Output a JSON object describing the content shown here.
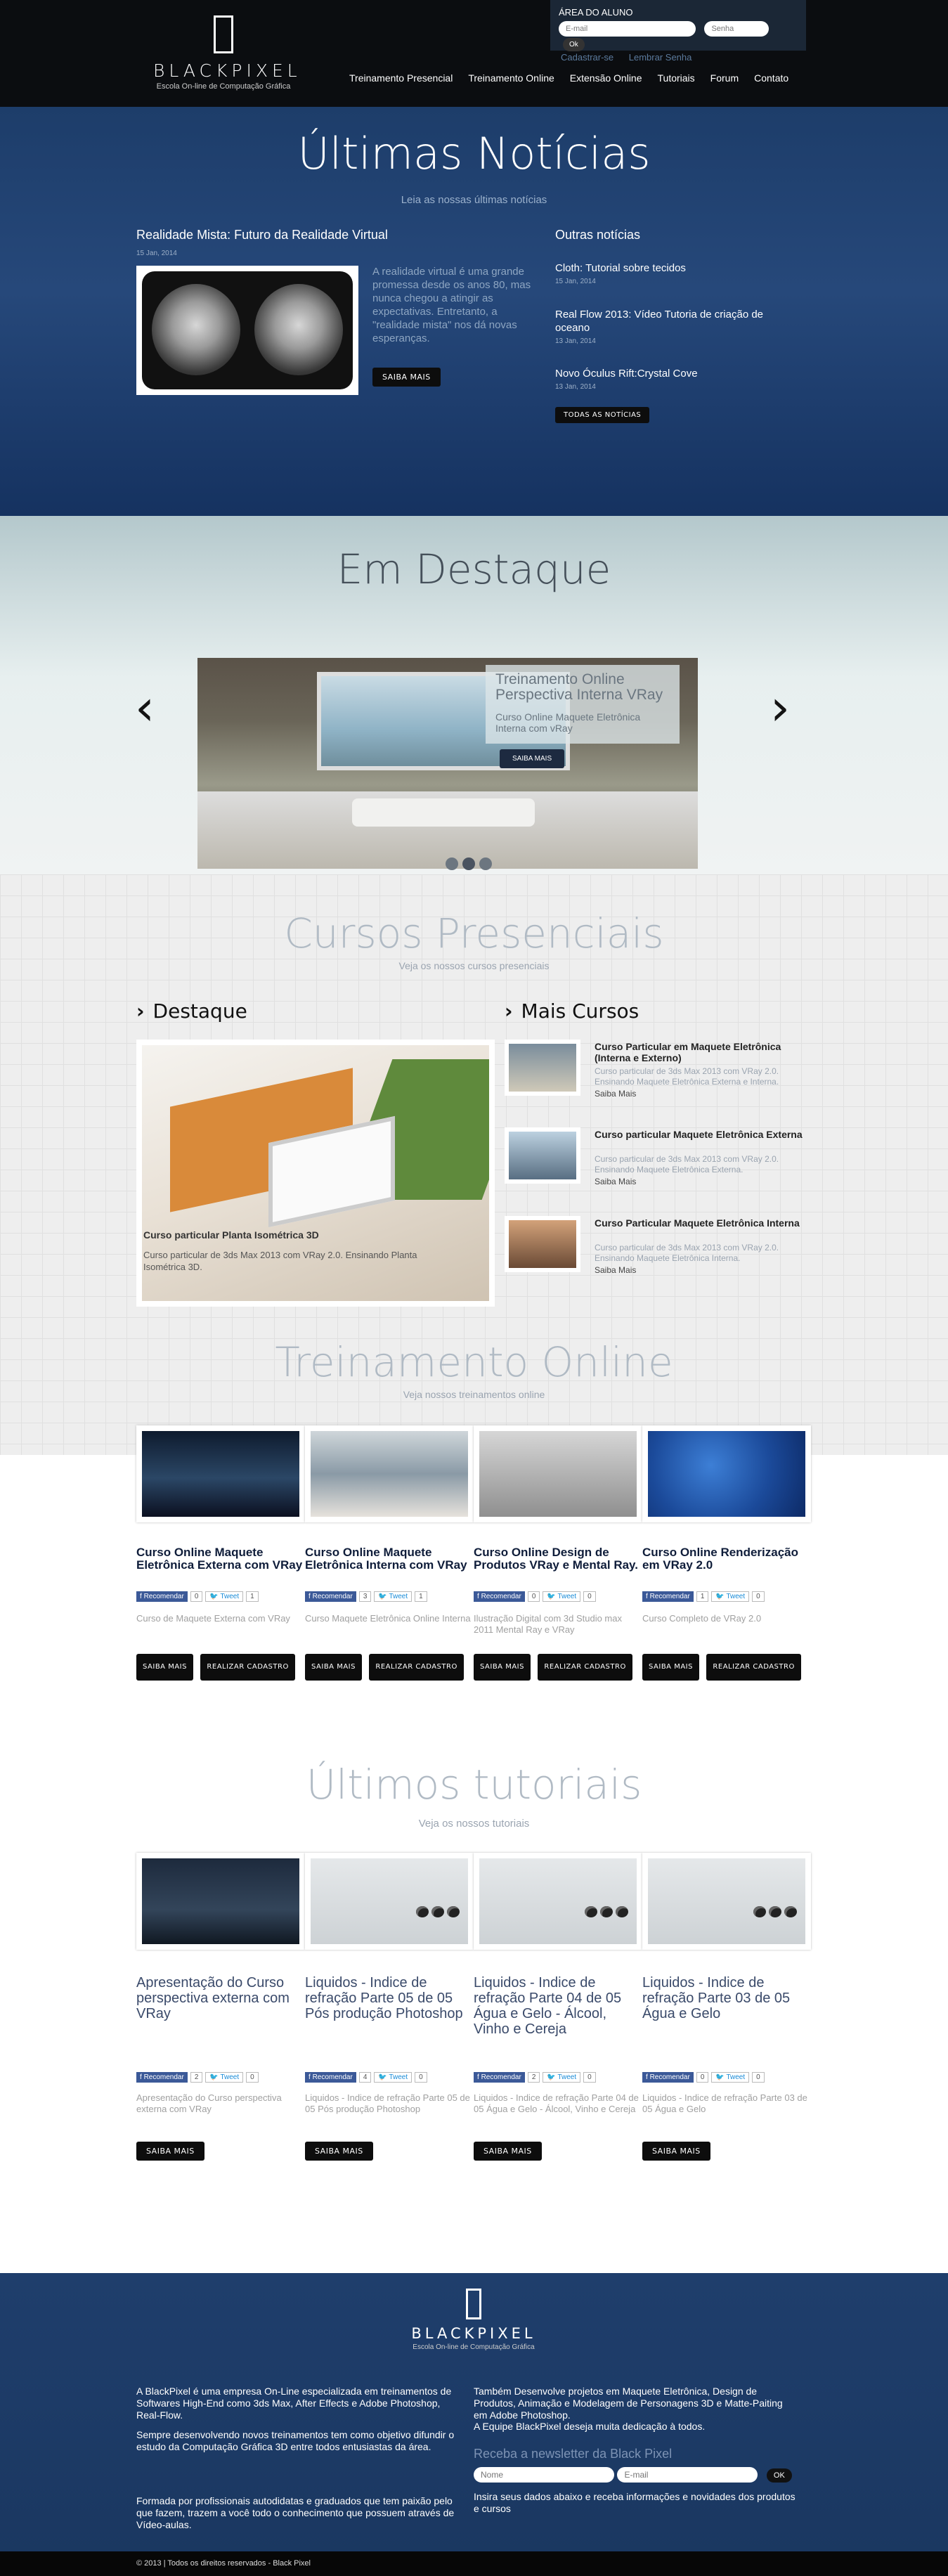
{
  "header": {
    "logo": {
      "brand": "BLACKPIXEL",
      "tagline": "Escola On-line de Computação Gráfica"
    },
    "login": {
      "title": "ÁREA DO ALUNO",
      "email_placeholder": "E-mail",
      "password_placeholder": "Senha",
      "ok": "Ok",
      "register": "Cadastrar-se",
      "remember": "Lembrar Senha"
    },
    "nav": [
      "Treinamento Presencial",
      "Treinamento Online",
      "Extensão Online",
      "Tutoriais",
      "Forum",
      "Contato"
    ]
  },
  "news": {
    "title": "Últimas Notícias",
    "subtitle": "Leia as nossas últimas notícias",
    "featured": {
      "title": "Realidade Mista: Futuro da Realidade Virtual",
      "date": "15 Jan, 2014",
      "text": "A realidade virtual é uma grande promessa desde os anos 80, mas nunca chegou a atingir as expectativas. Entretanto, a \"realidade mista\" nos dá novas esperanças.",
      "button": "SAIBA MAIS"
    },
    "others_title": "Outras notícias",
    "others": [
      {
        "title": "Cloth: Tutorial sobre tecidos",
        "date": "15 Jan, 2014"
      },
      {
        "title": "Real Flow 2013: Vídeo Tutoria de criação de oceano",
        "date": "13 Jan, 2014"
      },
      {
        "title": "Novo Óculus Rift:Crystal Cove",
        "date": "13 Jan, 2014"
      }
    ],
    "all_button": "TODAS AS NOTÍCIAS"
  },
  "highlight": {
    "title": "Em Destaque",
    "slide_title": "Treinamento Online Perspectiva Interna VRay",
    "slide_subtitle": "Curso Online Maquete Eletrônica Interna com vRay",
    "slide_button": "SAIBA MAIS",
    "prev_icon": "‹",
    "next_icon": "›"
  },
  "presenciais": {
    "title": "Cursos Presenciais",
    "subtitle": "Veja os nossos cursos presenciais",
    "destaque_heading": "Destaque",
    "mais_heading": "Mais Cursos",
    "destaque_course": {
      "title": "Curso particular Planta Isométrica 3D",
      "text": "Curso particular de 3ds Max 2013 com VRay 2.0. Ensinando Planta Isométrica 3D."
    },
    "more_courses": [
      {
        "title": "Curso Particular em Maquete Eletrônica (Interna e Externo)",
        "text": "Curso particular de 3ds Max 2013 com VRay 2.0. Ensinando Maquete Eletrônica Externa e Interna.",
        "link": "Saiba Mais"
      },
      {
        "title": "Curso particular Maquete Eletrônica Externa",
        "text": "Curso particular de 3ds Max 2013 com VRay 2.0. Ensinando Maquete Eletrônica Externa.",
        "link": "Saiba Mais"
      },
      {
        "title": "Curso Particular Maquete Eletrônica Interna",
        "text": "Curso particular de 3ds Max 2013 com VRay 2.0. Ensinando Maquete Eletrônica Interna.",
        "link": "Saiba Mais"
      }
    ]
  },
  "online": {
    "title": "Treinamento Online",
    "subtitle": "Veja nossos treinamentos online",
    "courses": [
      {
        "title": "Curso Online Maquete Eletrônica Externa com VRay",
        "fb_count": "0",
        "tw_count": "1",
        "desc": "Curso de Maquete Externa com VRay",
        "btn1": "SAIBA MAIS",
        "btn2": "REALIZAR CADASTRO"
      },
      {
        "title": "Curso Online Maquete Eletrônica Interna com VRay",
        "fb_count": "3",
        "tw_count": "1",
        "desc": "Curso Maquete Eletrônica Online Interna",
        "btn1": "SAIBA MAIS",
        "btn2": "REALIZAR CADASTRO"
      },
      {
        "title": "Curso Online Design de Produtos VRay e Mental Ray.",
        "fb_count": "0",
        "tw_count": "0",
        "desc": "Ilustração Digital com 3d Studio max 2011 Mental Ray e VRay",
        "btn1": "SAIBA MAIS",
        "btn2": "REALIZAR CADASTRO"
      },
      {
        "title": "Curso Online Renderização em VRay 2.0",
        "fb_count": "1",
        "tw_count": "0",
        "desc": "Curso Completo de VRay 2.0",
        "btn1": "SAIBA MAIS",
        "btn2": "REALIZAR CADASTRO"
      }
    ],
    "fb_label": "Recomendar",
    "tw_label": "Tweet"
  },
  "tutorials": {
    "title": "Últimos tutoriais",
    "subtitle": "Veja os nossos tutoriais",
    "items": [
      {
        "title": "Apresentação do Curso perspectiva externa com VRay",
        "fb_count": "2",
        "tw_count": "0",
        "desc": "Apresentação do Curso perspectiva externa com VRay",
        "btn": "SAIBA MAIS"
      },
      {
        "title": "Liquidos - Indice de refração Parte 05 de 05 Pós produção Photoshop",
        "fb_count": "4",
        "tw_count": "0",
        "desc": "Liquidos - Indice de refração Parte 05 de 05 Pós produção Photoshop",
        "btn": "SAIBA MAIS"
      },
      {
        "title": "Liquidos - Indice de refração Parte 04 de 05 Água e Gelo - Álcool, Vinho e Cereja",
        "fb_count": "2",
        "tw_count": "0",
        "desc": "Liquidos - Indice de refração Parte 04 de 05 Água e Gelo - Álcool, Vinho e Cereja",
        "btn": "SAIBA MAIS"
      },
      {
        "title": "Liquidos - Indice de refração Parte 03 de 05 Água e Gelo",
        "fb_count": "0",
        "tw_count": "0",
        "desc": "Liquidos - Indice de refração Parte 03 de 05 Água e Gelo",
        "btn": "SAIBA MAIS"
      }
    ]
  },
  "footer": {
    "brand": "BLACKPIXEL",
    "tagline": "Escola On-line de Computação Gráfica",
    "about1": "A BlackPixel é uma empresa On-Line especializada em treinamentos de Softwares High-End como 3ds Max, After Effects e Adobe Photoshop, Real-Flow.",
    "about2": "Sempre desenvolvendo novos treinamentos tem como objetivo difundir o estudo da Computação Gráfica 3D entre todos entusiastas da área.",
    "about3": "Formada por profissionais autodidatas e graduados que tem paixão pelo que fazem, trazem a você todo o conhecimento que possuem através de Vídeo-aulas.",
    "also": "Também Desenvolve projetos em Maquete Eletrônica, Design de Produtos, Animação e Modelagem de Personagens 3D e Matte-Paiting em Adobe Photoshop.",
    "team": "A Equipe BlackPixel deseja muita dedicação à todos.",
    "newsletter_title": "Receba a newsletter da Black Pixel",
    "name_placeholder": "Nome",
    "email_placeholder": "E-mail",
    "ok": "OK",
    "newsletter_text": "Insira seus dados abaixo e receba informações e novidades dos produtos e cursos",
    "copyright": "© 2013 | Todos os direitos reservados - Black Pixel"
  }
}
